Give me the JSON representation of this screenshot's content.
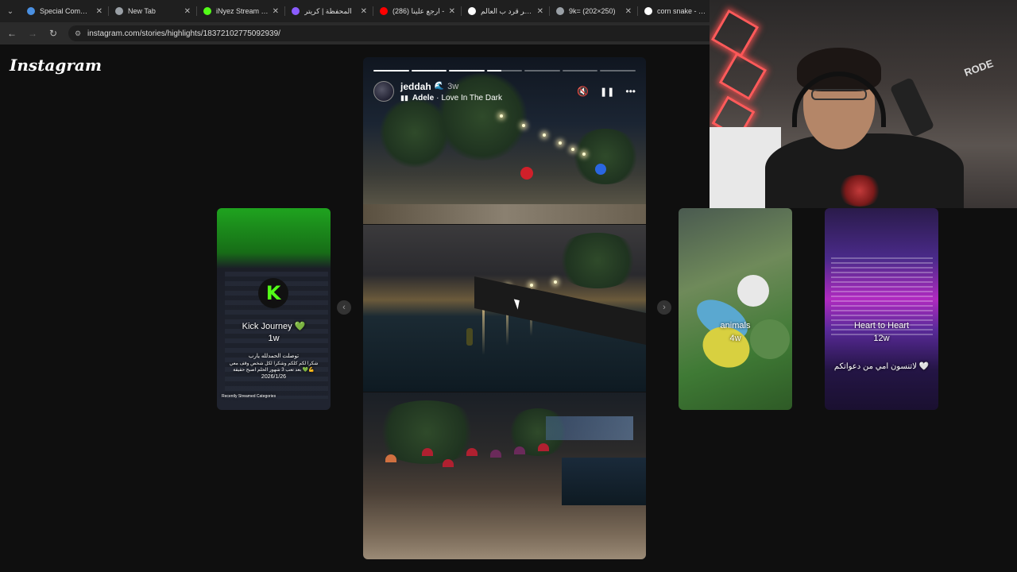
{
  "browser": {
    "tabs": [
      {
        "title": "Special Comman",
        "color": "#4a90e2"
      },
      {
        "title": "New Tab",
        "color": "#9aa0a6"
      },
      {
        "title": "iNyez Stream - W",
        "color": "#53fc18"
      },
      {
        "title": "المحفظة | كريتر",
        "color": "#8a5cff"
      },
      {
        "title": "(286) ارجع علينا -",
        "color": "#ff0000"
      },
      {
        "title": "اصغر قرد ب العالم",
        "color": "#ffffff"
      },
      {
        "title": "9k= (202×250)",
        "color": "#9aa0a6"
      },
      {
        "title": "corn snake - بحث",
        "color": "#ffffff"
      }
    ],
    "url": "instagram.com/stories/highlights/18372102775092939/"
  },
  "page": {
    "logo": "Instagram"
  },
  "story": {
    "username": "jeddah",
    "age": "3w",
    "music_artist": "Adele",
    "music_sep": "·",
    "music_song": "Love In The Dark",
    "progress": [
      1,
      1,
      1,
      0.4,
      0,
      0,
      0
    ],
    "controls": {
      "mute_icon": "🔇",
      "pause_icon": "❚❚",
      "more_icon": "•••"
    }
  },
  "cards": {
    "left": {
      "title": "Kick Journey 💚",
      "age": "1w",
      "caption_lines": [
        "توصلت الحمدلله يارب",
        "شكرا لكم كلكم وشكرا لكل شخص وقف معي",
        "بعد تعب 3 شهور الحلم اصبح حقيقة 💚💪",
        "2026/1/26",
        "Recently Streamed Categories"
      ]
    },
    "right1": {
      "title": "animals",
      "age": "4w"
    },
    "right2": {
      "title": "Heart to Heart",
      "age": "12w",
      "caption": "لاتنسون امي من دعواتكم 🤍"
    }
  },
  "webcam": {
    "mic_brand": "RODE"
  }
}
